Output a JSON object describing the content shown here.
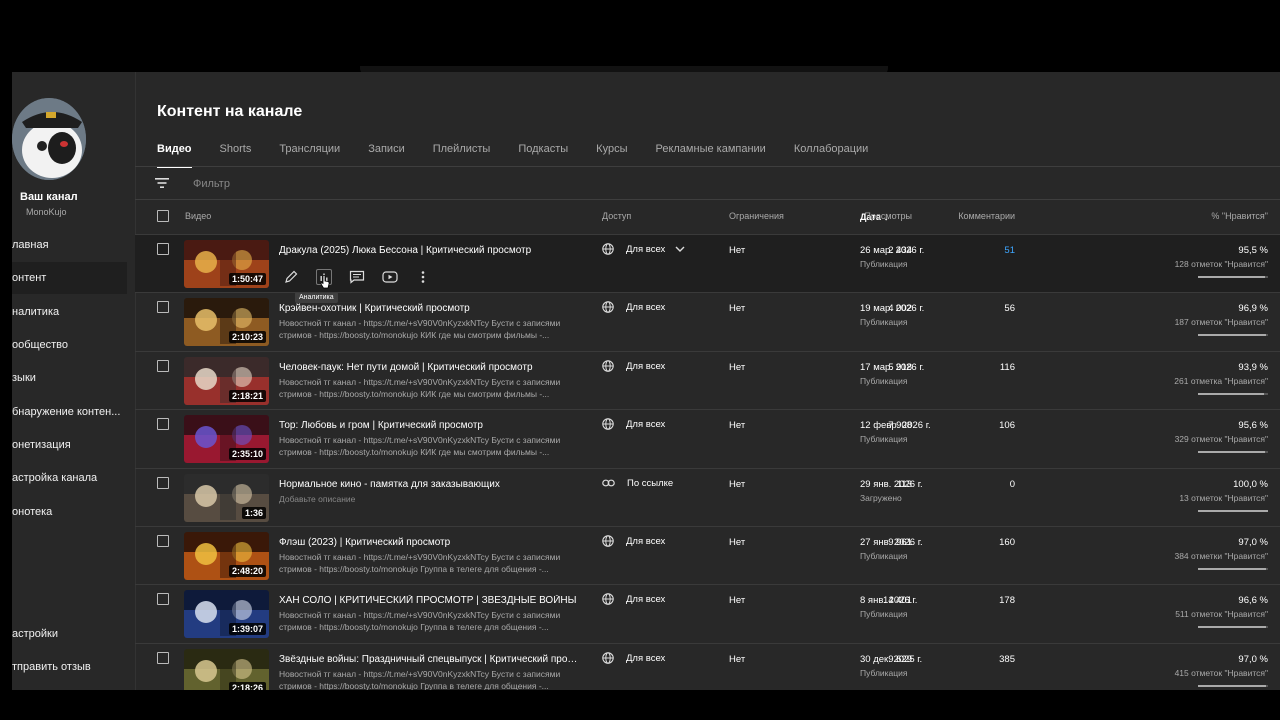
{
  "channel": {
    "name": "Ваш канал",
    "handle": "MonoKujo"
  },
  "sidebar": {
    "items": [
      {
        "label": "лавная"
      },
      {
        "label": "онтент"
      },
      {
        "label": "налитика"
      },
      {
        "label": "ообщество"
      },
      {
        "label": "зыки"
      },
      {
        "label": "бнаружение контен..."
      },
      {
        "label": "онетизация"
      },
      {
        "label": "астройка канала"
      },
      {
        "label": "онотека"
      }
    ],
    "bottom": [
      {
        "label": "астройки"
      },
      {
        "label": "тправить отзыв"
      }
    ]
  },
  "page": {
    "title": "Контент на канале"
  },
  "tabs": [
    "Видео",
    "Shorts",
    "Трансляции",
    "Записи",
    "Плейлисты",
    "Подкасты",
    "Курсы",
    "Рекламные кампании",
    "Коллаборации"
  ],
  "filter": {
    "placeholder": "Фильтр"
  },
  "columns": {
    "video": "Видео",
    "access": "Доступ",
    "restrictions": "Ограничения",
    "date": "Дата",
    "views": "Просмотры",
    "comments": "Комментарии",
    "likes": "% \"Нравится\""
  },
  "tooltip": "Аналитика",
  "videos": [
    {
      "title": "Дракула (2025) Люка Бессона | Критический просмотр",
      "desc": "",
      "duration": "1:50:47",
      "access": "Для всех",
      "restrictions": "Нет",
      "date": "26 мар. 2026 г.",
      "status": "Публикация",
      "views": "2 434",
      "comments": "51",
      "likes": "95,5 %",
      "likes_count": "128 отметок \"Нравится\"",
      "like_ratio": 0.955
    },
    {
      "title": "Крэйвен-охотник | Критический просмотр",
      "desc": "Новостной тг канал - https://t.me/+sV90V0nKyzxkNTcy Бусти с записями стримов - https://boosty.to/monokujo КИК где мы смотрим фильмы -...",
      "duration": "2:10:23",
      "access": "Для всех",
      "restrictions": "Нет",
      "date": "19 мар. 2026 г.",
      "status": "Публикация",
      "views": "4 002",
      "comments": "56",
      "likes": "96,9 %",
      "likes_count": "187 отметок \"Нравится\"",
      "like_ratio": 0.969
    },
    {
      "title": "Человек-паук: Нет пути домой | Критический просмотр",
      "desc": "Новостной тг канал - https://t.me/+sV90V0nKyzxkNTcy Бусти с записями стримов - https://boosty.to/monokujo КИК где мы смотрим фильмы -...",
      "duration": "2:18:21",
      "access": "Для всех",
      "restrictions": "Нет",
      "date": "17 мар. 2026 г.",
      "status": "Публикация",
      "views": "5 918",
      "comments": "116",
      "likes": "93,9 %",
      "likes_count": "261 отметка \"Нравится\"",
      "like_ratio": 0.939
    },
    {
      "title": "Тор: Любовь и гром | Критический просмотр",
      "desc": "Новостной тг канал - https://t.me/+sV90V0nKyzxkNTcy Бусти с записями стримов - https://boosty.to/monokujo КИК где мы смотрим фильмы -...",
      "duration": "2:35:10",
      "access": "Для всех",
      "restrictions": "Нет",
      "date": "12 февр. 2026 г.",
      "status": "Публикация",
      "views": "7 908",
      "comments": "106",
      "likes": "95,6 %",
      "likes_count": "329 отметок \"Нравится\"",
      "like_ratio": 0.956
    },
    {
      "title": "Нормальное кино - памятка для заказывающих",
      "desc": "Добавьте описание",
      "duration": "1:36",
      "access": "По ссылке",
      "restrictions": "Нет",
      "date": "29 янв. 2026 г.",
      "status": "Загружено",
      "views": "113",
      "comments": "0",
      "likes": "100,0 %",
      "likes_count": "13 отметок \"Нравится\"",
      "like_ratio": 1.0
    },
    {
      "title": "Флэш (2023) | Критический просмотр",
      "desc": "Новостной тг канал - https://t.me/+sV90V0nKyzxkNTcy Бусти с записями стримов - https://boosty.to/monokujo Группа в телеге для общения -...",
      "duration": "2:48:20",
      "access": "Для всех",
      "restrictions": "Нет",
      "date": "27 янв. 2026 г.",
      "status": "Публикация",
      "views": "9 961",
      "comments": "160",
      "likes": "97,0 %",
      "likes_count": "384 отметки \"Нравится\"",
      "like_ratio": 0.97
    },
    {
      "title": "ХАН СОЛО | КРИТИЧЕСКИЙ ПРОСМОТР | ЗВЕЗДНЫЕ ВОЙНЫ",
      "desc": "Новостной тг канал - https://t.me/+sV90V0nKyzxkNTcy Бусти с записями стримов - https://boosty.to/monokujo Группа в телеге для общения -...",
      "duration": "1:39:07",
      "access": "Для всех",
      "restrictions": "Нет",
      "date": "8 янв. 2026 г.",
      "status": "Публикация",
      "views": "14 401",
      "comments": "178",
      "likes": "96,6 %",
      "likes_count": "511 отметок \"Нравится\"",
      "like_ratio": 0.966
    },
    {
      "title": "Звёздные войны: Праздничный спецвыпуск | Критический просмо...",
      "desc": "Новостной тг канал - https://t.me/+sV90V0nKyzxkNTcy Бусти с записями стримов - https://boosty.to/monokujo Группа в телеге для общения -...",
      "duration": "2:18:26",
      "access": "Для всех",
      "restrictions": "Нет",
      "date": "30 дек. 2025 г.",
      "status": "Публикация",
      "views": "9 629",
      "comments": "385",
      "likes": "97,0 %",
      "likes_count": "415 отметок \"Нравится\"",
      "like_ratio": 0.97
    }
  ],
  "colors": {
    "background": "#282828",
    "accent_link": "#3ea6ff"
  }
}
